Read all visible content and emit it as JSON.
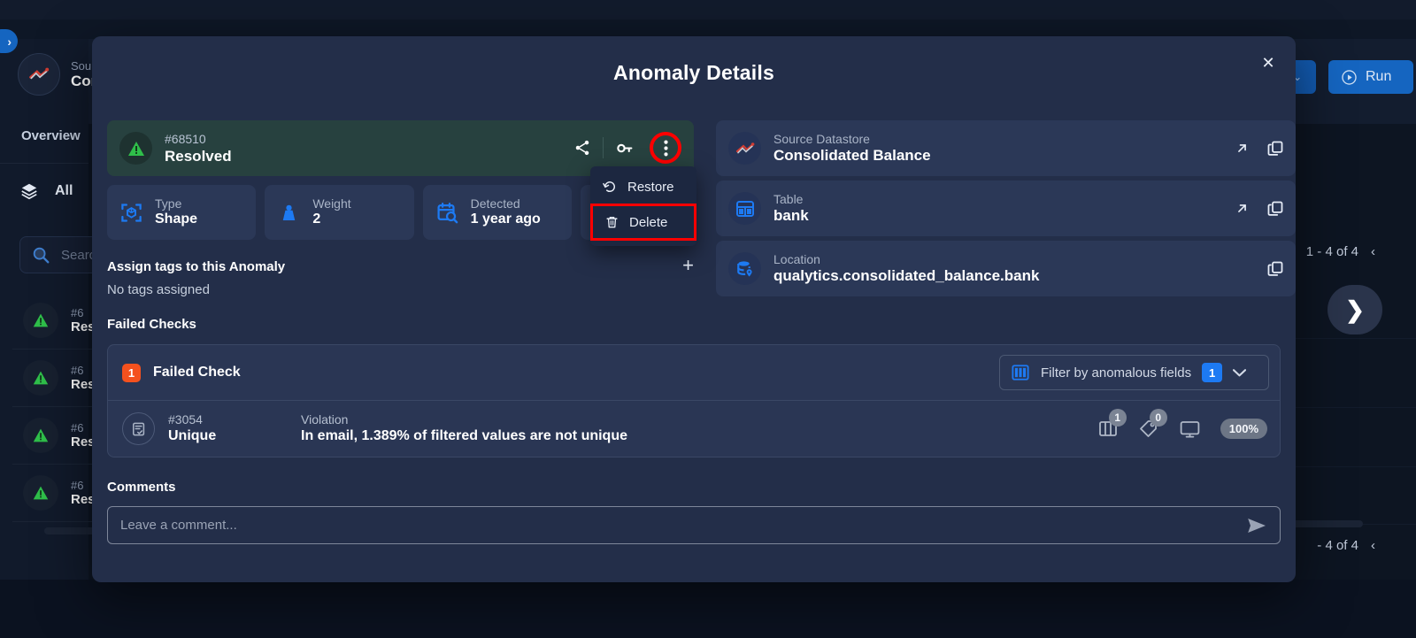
{
  "background": {
    "collapse_label": "›",
    "datastore": {
      "label": "Sou",
      "value": "Con"
    },
    "overview_tab": "Overview",
    "all_filter": "All",
    "search_placeholder": "Search",
    "anomaly_items": [
      {
        "id": "#6",
        "status": "Res"
      },
      {
        "id": "#6",
        "status": "Res"
      },
      {
        "id": "#6",
        "status": "Res"
      },
      {
        "id": "#6",
        "status": "Res"
      }
    ],
    "run_button": "Run",
    "pagination_top": "1 - 4 of 4",
    "pagination_bottom": "- 4 of 4",
    "next_arrow": "❯"
  },
  "modal": {
    "title": "Anomaly Details",
    "close_label": "✕",
    "status": {
      "id": "#68510",
      "state": "Resolved",
      "actions": [
        "share-icon",
        "key-icon",
        "kebab-icon"
      ]
    },
    "tiles": [
      {
        "icon": "shape-scan-icon",
        "label": "Type",
        "value": "Shape"
      },
      {
        "icon": "weight-icon",
        "label": "Weight",
        "value": "2"
      },
      {
        "icon": "calendar-search-icon",
        "label": "Detected",
        "value": "1 year ago"
      },
      {
        "icon": "database-search-icon",
        "label": "",
        "value": ""
      }
    ],
    "menu": {
      "restore": "Restore",
      "delete": "Delete"
    },
    "tags": {
      "title": "Assign tags to this Anomaly",
      "empty": "No tags assigned",
      "add_label": "+"
    },
    "info_cards": [
      {
        "icon": "datastore-icon",
        "label": "Source Datastore",
        "value": "Consolidated Balance",
        "has_open": true
      },
      {
        "icon": "table-icon",
        "label": "Table",
        "value": "bank",
        "has_open": true
      },
      {
        "icon": "location-db-icon",
        "label": "Location",
        "value": "qualytics.consolidated_balance.bank",
        "has_open": false
      }
    ],
    "failed_checks": {
      "section_title": "Failed Checks",
      "count": "1",
      "bar_label": "Failed Check",
      "filter_label": "Filter by anomalous fields",
      "filter_badge": "1",
      "row": {
        "id": "#3054",
        "name": "Unique",
        "violation_label": "Violation",
        "violation_text": "In email, 1.389% of filtered values are not unique",
        "stats": [
          {
            "icon": "columns-icon",
            "value": "1"
          },
          {
            "icon": "tag-icon",
            "value": "0"
          },
          {
            "icon": "monitor-icon",
            "value": ""
          }
        ],
        "percent": "100%"
      }
    },
    "comments": {
      "title": "Comments",
      "placeholder": "Leave a comment...",
      "send_icon": "send-icon"
    }
  },
  "colors": {
    "modal_bg": "#232e49",
    "tile_bg": "#2b3857",
    "resolved_bg": "#27413f",
    "resolved_green": "#34c759",
    "accent_blue": "#1d7af3",
    "danger_red": "#ff0000",
    "badge_orange": "#f4511e"
  }
}
